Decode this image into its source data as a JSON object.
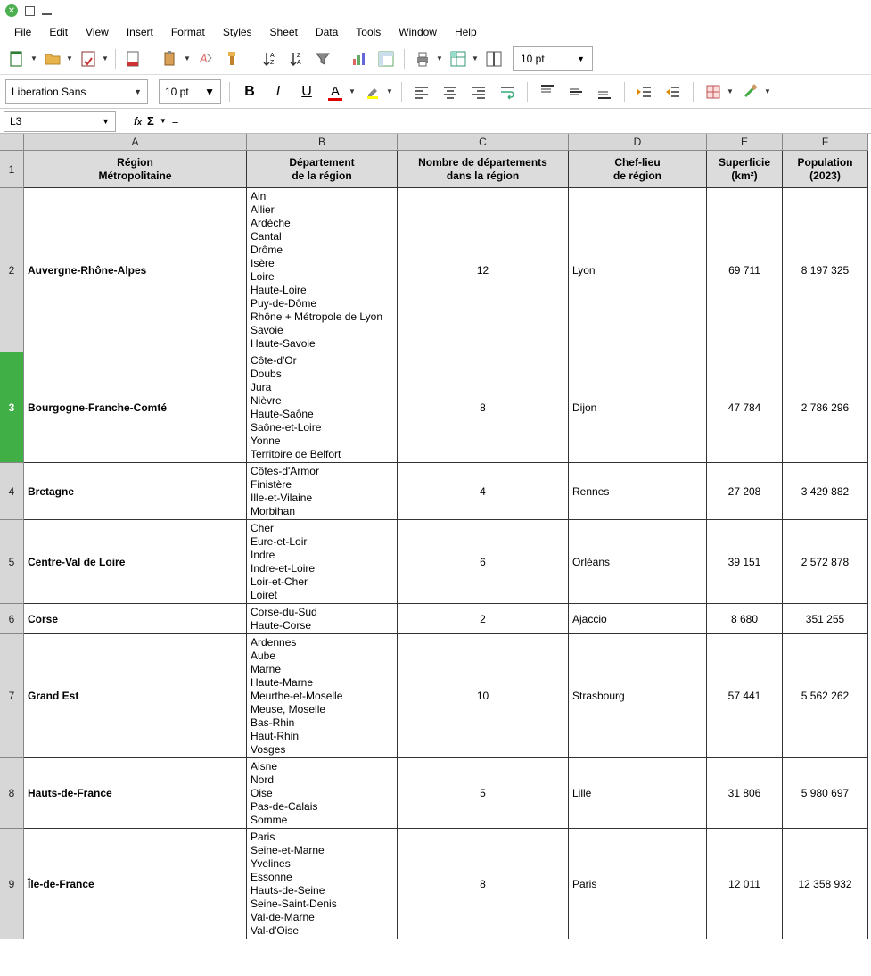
{
  "menubar": [
    "File",
    "Edit",
    "View",
    "Insert",
    "Format",
    "Styles",
    "Sheet",
    "Data",
    "Tools",
    "Window",
    "Help"
  ],
  "toolbar_pointsize": "10 pt",
  "font": {
    "name": "Liberation Sans",
    "size": "10 pt"
  },
  "namebox": "L3",
  "columns": [
    {
      "letter": "A",
      "label": "Région\nMétropolitaine"
    },
    {
      "letter": "B",
      "label": "Département\nde la région"
    },
    {
      "letter": "C",
      "label": "Nombre de départements\ndans la région"
    },
    {
      "letter": "D",
      "label": "Chef-lieu\nde région"
    },
    {
      "letter": "E",
      "label": "Superficie\n(km²)"
    },
    {
      "letter": "F",
      "label": "Population\n(2023)"
    }
  ],
  "selected_row": 3,
  "rows": [
    {
      "n": 2,
      "region": "Auvergne-Rhône-Alpes",
      "depts": "Ain\nAllier\nArdèche\nCantal\nDrôme\nIsère\nLoire\nHaute-Loire\nPuy-de-Dôme\nRhône + Métropole de Lyon\nSavoie\nHaute-Savoie",
      "count": "12",
      "chef": "Lyon",
      "area": "69 711",
      "pop": "8 197 325"
    },
    {
      "n": 3,
      "region": "Bourgogne-Franche-Comté",
      "depts": "Côte-d'Or\nDoubs\nJura\nNièvre\nHaute-Saône\nSaône-et-Loire\nYonne\nTerritoire de Belfort",
      "count": "8",
      "chef": "Dijon",
      "area": "47 784",
      "pop": "2 786 296"
    },
    {
      "n": 4,
      "region": "Bretagne",
      "depts": "Côtes-d'Armor\nFinistère\nIlle-et-Vilaine\nMorbihan",
      "count": "4",
      "chef": "Rennes",
      "area": "27 208",
      "pop": "3 429 882"
    },
    {
      "n": 5,
      "region": "Centre-Val de Loire",
      "depts": "Cher\nEure-et-Loir\nIndre\nIndre-et-Loire\nLoir-et-Cher\nLoiret",
      "count": "6",
      "chef": "Orléans",
      "area": "39 151",
      "pop": "2 572 878"
    },
    {
      "n": 6,
      "region": "Corse",
      "depts": "Corse-du-Sud\nHaute-Corse",
      "count": "2",
      "chef": "Ajaccio",
      "area": "8 680",
      "pop": "351 255"
    },
    {
      "n": 7,
      "region": "Grand Est",
      "depts": "Ardennes\nAube\nMarne\nHaute-Marne\nMeurthe-et-Moselle\nMeuse, Moselle\nBas-Rhin\nHaut-Rhin\nVosges",
      "count": "10",
      "chef": "Strasbourg",
      "area": "57 441",
      "pop": "5 562 262"
    },
    {
      "n": 8,
      "region": "Hauts-de-France",
      "depts": "Aisne\nNord\nOise\nPas-de-Calais\nSomme",
      "count": "5",
      "chef": "Lille",
      "area": "31 806",
      "pop": "5 980 697"
    },
    {
      "n": 9,
      "region": "Île-de-France",
      "depts": "Paris\nSeine-et-Marne\nYvelines\nEssonne\nHauts-de-Seine\nSeine-Saint-Denis\nVal-de-Marne\nVal-d'Oise",
      "count": "8",
      "chef": "Paris",
      "area": "12 011",
      "pop": "12 358 932"
    }
  ]
}
